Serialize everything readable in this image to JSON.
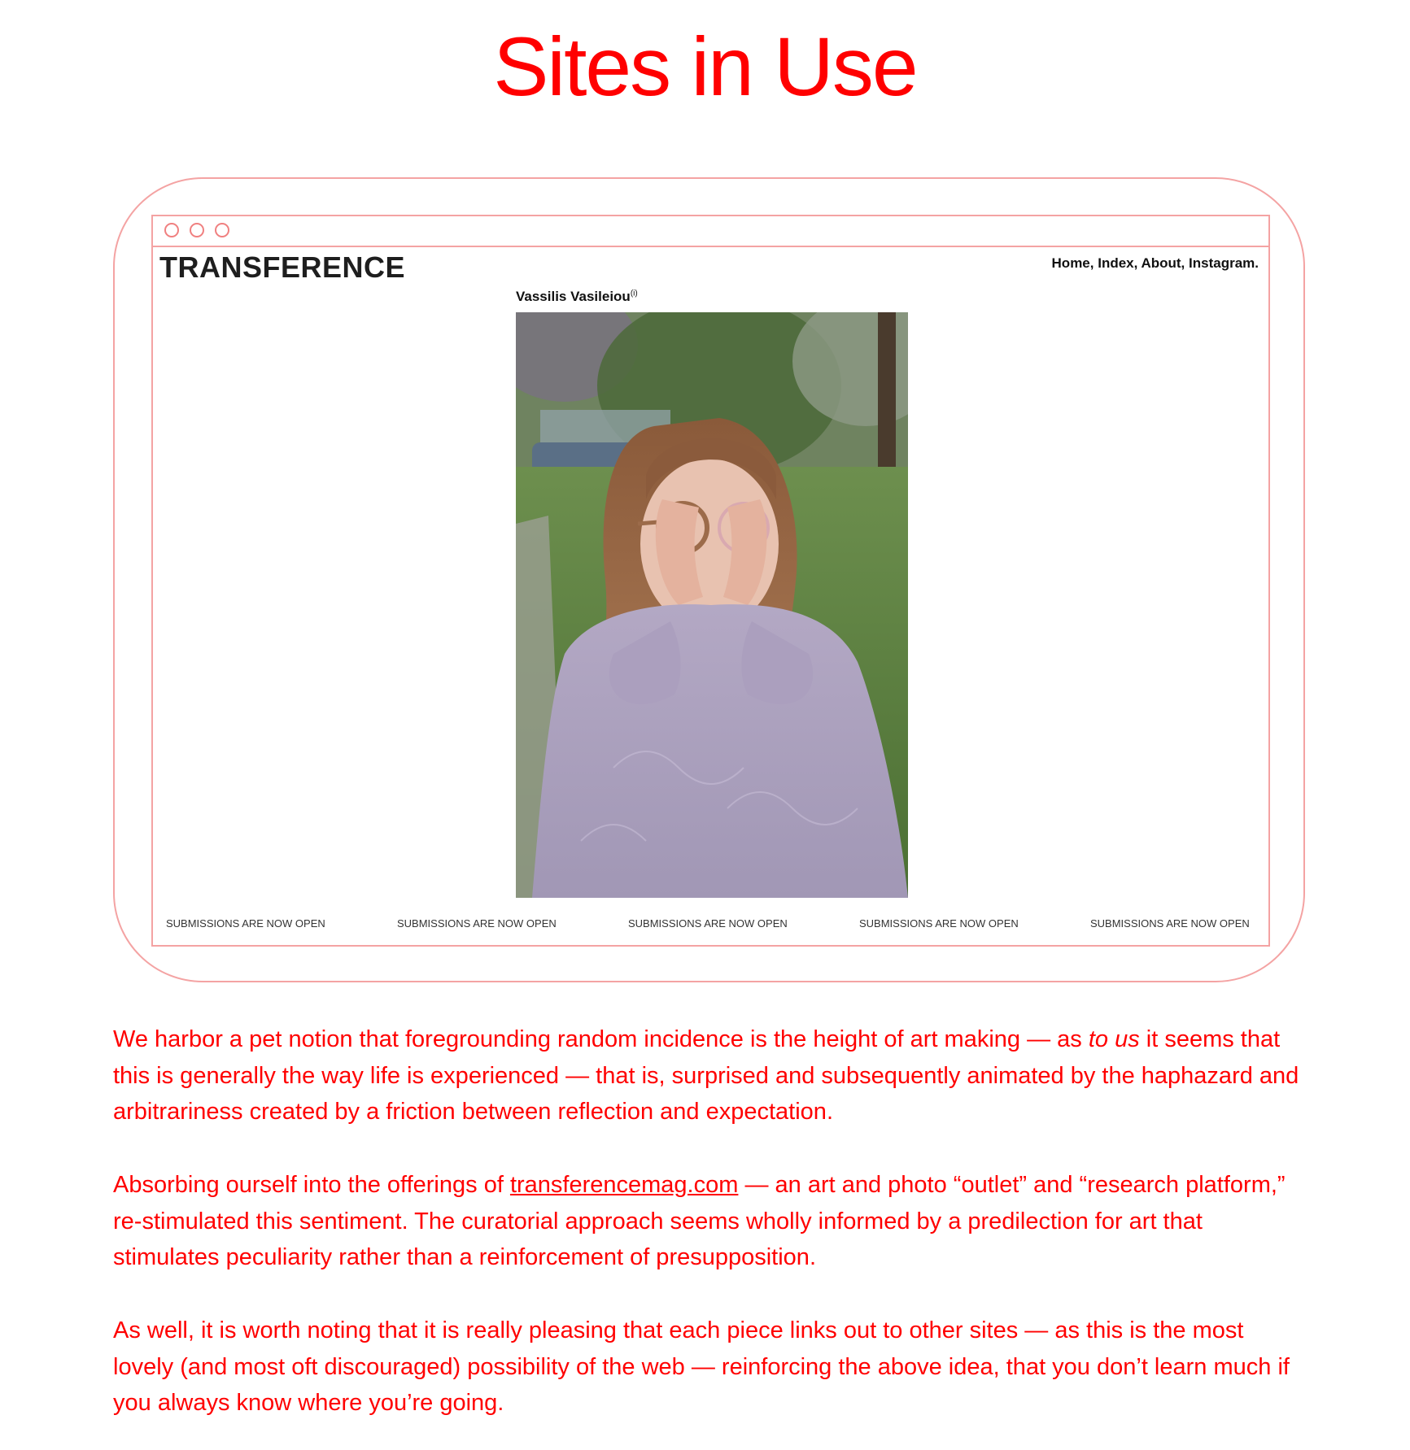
{
  "page": {
    "title": "Sites in Use"
  },
  "browser": {
    "site_logo": "TRANSFERENCE",
    "nav": [
      "Home,",
      "Index,",
      "About,",
      "Instagram."
    ],
    "artist_name": "Vassilis Vasileiou",
    "artist_info_marker": "(i)",
    "ticker": [
      "SUBMISSIONS ARE NOW OPEN",
      "SUBMISSIONS ARE NOW OPEN",
      "SUBMISSIONS ARE NOW OPEN",
      "SUBMISSIONS ARE NOW OPEN",
      "SUBMISSIONS ARE NOW OPEN"
    ]
  },
  "article": {
    "p1_a": "We harbor a pet notion that foregrounding random incidence is the height of art making — as ",
    "p1_em": "to us",
    "p1_b": " it seems that this is generally the way life is experienced — that is, surprised and subsequently animated by the haphazard and arbitrariness created by a friction between reflection and expectation.",
    "p2_a": "Absorbing ourself into the offerings of ",
    "p2_link": "transferencemag.com",
    "p2_b": " — an art and photo “outlet” and “research platform,” re-stimulated this sentiment. The curatorial approach seems wholly informed by a predilection for art that stimulates peculiarity rather than a reinforcement of presupposition.",
    "p3": "As well, it is worth noting that it is really pleasing that each piece links out to other sites — as this is the most lovely (and most oft discouraged) possibility of the web — reinforcing the above idea, that you don’t learn much if you always know where you’re going."
  },
  "colors": {
    "accent": "#ff0000",
    "frame": "#f4a3a3"
  }
}
